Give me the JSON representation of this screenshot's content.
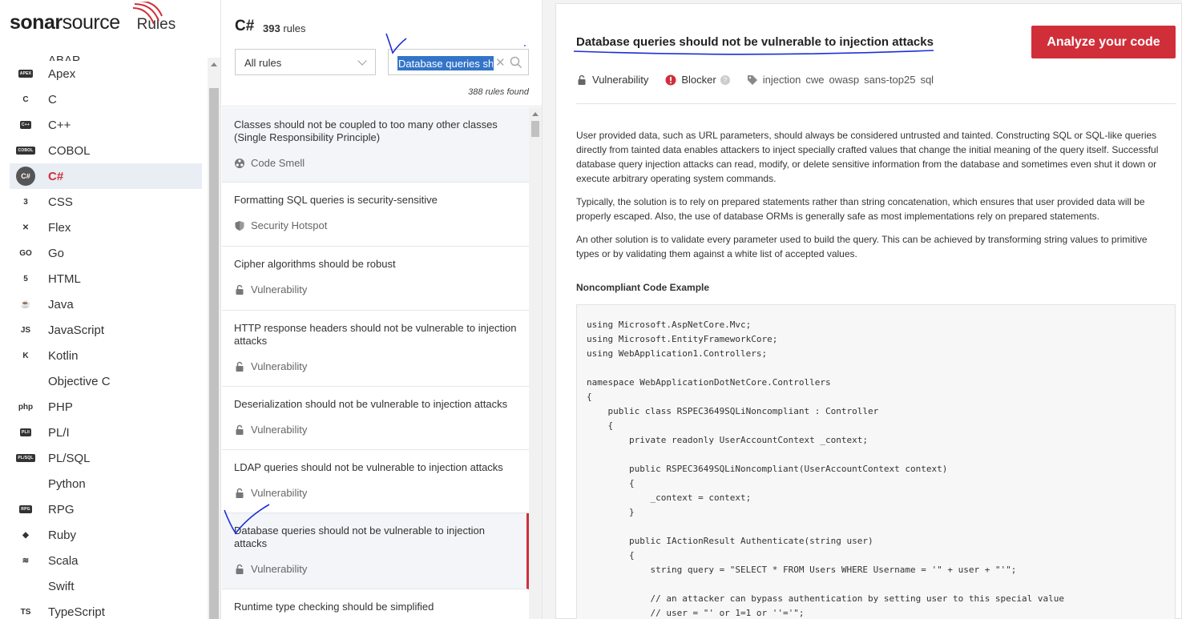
{
  "brand": {
    "logo_prefix": "sonar",
    "logo_suffix": "source",
    "section": "Rules"
  },
  "sidebar": {
    "partial_top_label": "ABAP",
    "languages": [
      {
        "label": "Apex",
        "icon": "apex-icon",
        "badge": "APEX"
      },
      {
        "label": "C",
        "icon": "c-icon",
        "badge": "C"
      },
      {
        "label": "C++",
        "icon": "cpp-icon",
        "badge": "C++"
      },
      {
        "label": "COBOL",
        "icon": "cobol-icon",
        "badge": "COBOL"
      },
      {
        "label": "C#",
        "icon": "csharp-icon",
        "badge": "C#",
        "active": true
      },
      {
        "label": "CSS",
        "icon": "css-icon",
        "badge": "3"
      },
      {
        "label": "Flex",
        "icon": "flex-icon",
        "badge": "✕"
      },
      {
        "label": "Go",
        "icon": "go-icon",
        "badge": "GO"
      },
      {
        "label": "HTML",
        "icon": "html-icon",
        "badge": "5"
      },
      {
        "label": "Java",
        "icon": "java-icon",
        "badge": "☕"
      },
      {
        "label": "JavaScript",
        "icon": "javascript-icon",
        "badge": "JS"
      },
      {
        "label": "Kotlin",
        "icon": "kotlin-icon",
        "badge": "K"
      },
      {
        "label": "Objective C",
        "icon": "apple-icon",
        "badge": ""
      },
      {
        "label": "PHP",
        "icon": "php-icon",
        "badge": "php"
      },
      {
        "label": "PL/I",
        "icon": "pli-icon",
        "badge": "PL/I"
      },
      {
        "label": "PL/SQL",
        "icon": "plsql-icon",
        "badge": "PL/SQL"
      },
      {
        "label": "Python",
        "icon": "python-icon",
        "badge": ""
      },
      {
        "label": "RPG",
        "icon": "rpg-icon",
        "badge": "RPG"
      },
      {
        "label": "Ruby",
        "icon": "ruby-icon",
        "badge": "◆"
      },
      {
        "label": "Scala",
        "icon": "scala-icon",
        "badge": "≋"
      },
      {
        "label": "Swift",
        "icon": "swift-icon",
        "badge": ""
      },
      {
        "label": "TypeScript",
        "icon": "typescript-icon",
        "badge": "TS"
      }
    ]
  },
  "rules_panel": {
    "language": "C#",
    "count_number": "393",
    "count_label": "rules",
    "filter_value": "All rules",
    "search_value": "Database queries sh",
    "found_text": "388 rules found",
    "rules": [
      {
        "title": "Classes should not be coupled to too many other classes (Single Responsibility Principle)",
        "type": "Code Smell",
        "icon": "code-smell-icon"
      },
      {
        "title": "Formatting SQL queries is security-sensitive",
        "type": "Security Hotspot",
        "icon": "shield-icon"
      },
      {
        "title": "Cipher algorithms should be robust",
        "type": "Vulnerability",
        "icon": "lock-icon"
      },
      {
        "title": "HTTP response headers should not be vulnerable to injection attacks",
        "type": "Vulnerability",
        "icon": "lock-icon"
      },
      {
        "title": "Deserialization should not be vulnerable to injection attacks",
        "type": "Vulnerability",
        "icon": "lock-icon"
      },
      {
        "title": "LDAP queries should not be vulnerable to injection attacks",
        "type": "Vulnerability",
        "icon": "lock-icon"
      },
      {
        "title": "Database queries should not be vulnerable to injection attacks",
        "type": "Vulnerability",
        "icon": "lock-icon",
        "selected": true
      },
      {
        "title": "Runtime type checking should be simplified",
        "type": "",
        "icon": ""
      }
    ]
  },
  "detail": {
    "title": "Database queries should not be vulnerable to injection attacks",
    "analyze_button": "Analyze your code",
    "type": "Vulnerability",
    "severity": "Blocker",
    "tags": [
      "injection",
      "cwe",
      "owasp",
      "sans-top25",
      "sql"
    ],
    "paragraphs": [
      "User provided data, such as URL parameters, should always be considered untrusted and tainted. Constructing SQL or SQL-like queries directly from tainted data enables attackers to inject specially crafted values that change the initial meaning of the query itself. Successful database query injection attacks can read, modify, or delete sensitive information from the database and sometimes even shut it down or execute arbitrary operating system commands.",
      "Typically, the solution is to rely on prepared statements rather than string concatenation, which ensures that user provided data will be properly escaped. Also, the use of database ORMs is generally safe as most implementations rely on prepared statements.",
      "An other solution is to validate every parameter used to build the query. This can be achieved by transforming string values to primitive types or by validating them against a white list of accepted values."
    ],
    "code_heading": "Noncompliant Code Example",
    "code_lines": [
      "using Microsoft.AspNetCore.Mvc;",
      "using Microsoft.EntityFrameworkCore;",
      "using WebApplication1.Controllers;",
      "",
      "namespace WebApplicationDotNetCore.Controllers",
      "{",
      "    public class RSPEC3649SQLiNoncompliant : Controller",
      "    {",
      "        private readonly UserAccountContext _context;",
      "",
      "        public RSPEC3649SQLiNoncompliant(UserAccountContext context)",
      "        {",
      "            _context = context;",
      "        }",
      "",
      "        public IActionResult Authenticate(string user)",
      "        {",
      "            string query = \"SELECT * FROM Users WHERE Username = '\" + user + \"'\";",
      "",
      "            // an attacker can bypass authentication by setting user to this special value",
      "            // user = \"' or 1=1 or ''='\";"
    ]
  },
  "colors": {
    "accent": "#d02f3a",
    "active_bg": "#e8eef4",
    "annotation": "#1a2fd6"
  }
}
